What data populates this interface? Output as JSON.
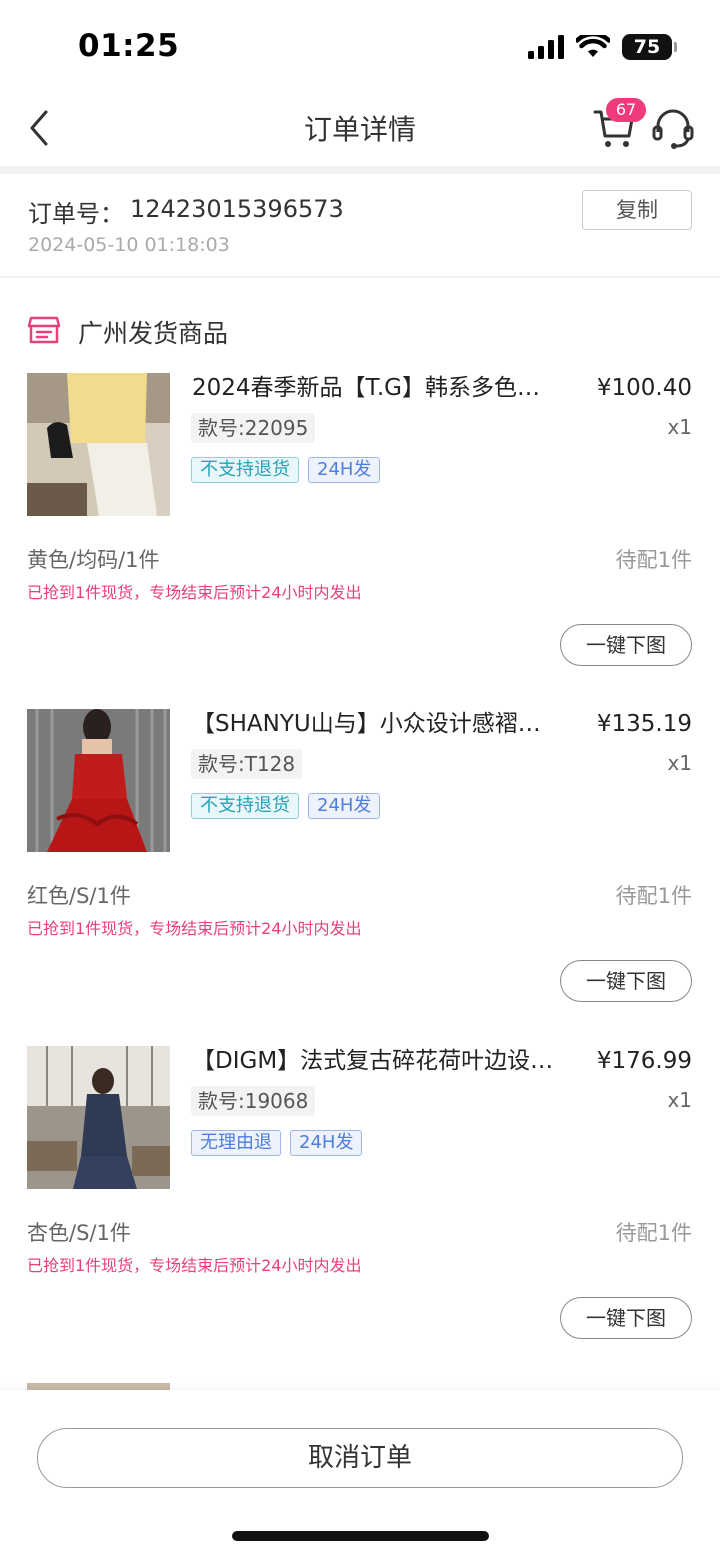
{
  "status_bar": {
    "time": "01:25",
    "battery": "75"
  },
  "nav": {
    "title": "订单详情",
    "cart_badge": "67"
  },
  "order": {
    "number_label": "订单号：",
    "number": "12423015396573",
    "datetime": "2024-05-10 01:18:03",
    "copy_label": "复制"
  },
  "section": {
    "title": "广州发货商品"
  },
  "products": [
    {
      "title": "2024春季新品【T.G】韩系多色…",
      "price": "¥100.40",
      "qty": "x1",
      "sku": "款号:22095",
      "tags": [
        "不支持退货",
        "24H发"
      ],
      "spec": "黄色/均码/1件",
      "status": "待配1件",
      "note": "已抢到1件现货，专场结束后预计24小时内发出",
      "download_label": "一键下图"
    },
    {
      "title": "【SHANYU山与】小众设计感褶…",
      "price": "¥135.19",
      "qty": "x1",
      "sku": "款号:T128",
      "tags": [
        "不支持退货",
        "24H发"
      ],
      "spec": "红色/S/1件",
      "status": "待配1件",
      "note": "已抢到1件现货，专场结束后预计24小时内发出",
      "download_label": "一键下图"
    },
    {
      "title": "【DIGM】法式复古碎花荷叶边设…",
      "price": "¥176.99",
      "qty": "x1",
      "sku": "款号:19068",
      "tags": [
        "无理由退",
        "24H发"
      ],
      "spec": "杏色/S/1件",
      "status": "待配1件",
      "note": "已抢到1件现货，专场结束后预计24小时内发出",
      "download_label": "一键下图"
    }
  ],
  "footer": {
    "cancel_label": "取消订单"
  },
  "colors": {
    "accent_pink": "#f03a7c",
    "note_pink": "#e8407e",
    "tag_cyan": "#2aa1b8",
    "tag_blue": "#4f7fd6"
  }
}
